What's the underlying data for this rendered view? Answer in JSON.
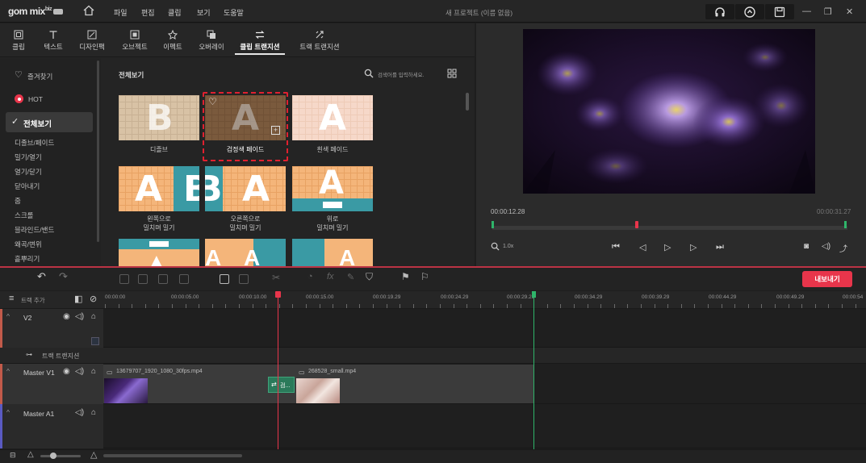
{
  "app": {
    "logo": "gom mix",
    "logo_sub": "biz",
    "menu": [
      "파일",
      "편집",
      "클립",
      "보기",
      "도움말"
    ],
    "project_title": "새 프로젝트 (이름 없음)"
  },
  "tools": [
    {
      "label": "클립"
    },
    {
      "label": "텍스트"
    },
    {
      "label": "디자인팩"
    },
    {
      "label": "오브젝트"
    },
    {
      "label": "이펙트"
    },
    {
      "label": "오버레이"
    },
    {
      "label": "클립 트랜지션",
      "active": true
    },
    {
      "label": "트랙 트랜지션"
    }
  ],
  "categories": {
    "favorites": "즐겨찾기",
    "hot": "HOT",
    "all": "전체보기",
    "items": [
      "디졸브/페이드",
      "밀기/열기",
      "열기/닫기",
      "닫아내기",
      "줌",
      "스크롤",
      "블라인드/밴드",
      "왜곡/변위",
      "흩뿌리기"
    ]
  },
  "grid": {
    "title": "전체보기",
    "search_placeholder": "검색어를 입력하세요.",
    "items": [
      {
        "label": "디졸브"
      },
      {
        "label": "검정색 페이드",
        "selected": true
      },
      {
        "label": "흰색 페이드"
      },
      {
        "label": "왼쪽으로\n밀치며 밀기"
      },
      {
        "label": "오른쪽으로\n밀치며 밀기"
      },
      {
        "label": "위로\n밀치며 밀기"
      }
    ]
  },
  "preview": {
    "current_time": "00:00:12.28",
    "total_time": "00:00:31.27",
    "zoom": "1.0x"
  },
  "export_label": "내보내기",
  "timeline": {
    "add_track": "트랙 추가",
    "ruler": [
      "00:00:00",
      "00:00:05.00",
      "00:00:10.00",
      "00:00:15.00",
      "00:00:19.29",
      "00:00:24.29",
      "00:00:29.29",
      "00:00:34.29",
      "00:00:39.29",
      "00:00:44.29",
      "00:00:49.29",
      "00:00:54"
    ],
    "tracks": {
      "v2": "V2",
      "track_transition": "트랙 트랜지션",
      "master_v1": "Master V1",
      "master_a1": "Master A1"
    },
    "clips": [
      {
        "name": "13679707_1920_1080_30fps.mp4"
      },
      {
        "name": "268528_small.mp4"
      }
    ],
    "transition_label": "검..."
  }
}
